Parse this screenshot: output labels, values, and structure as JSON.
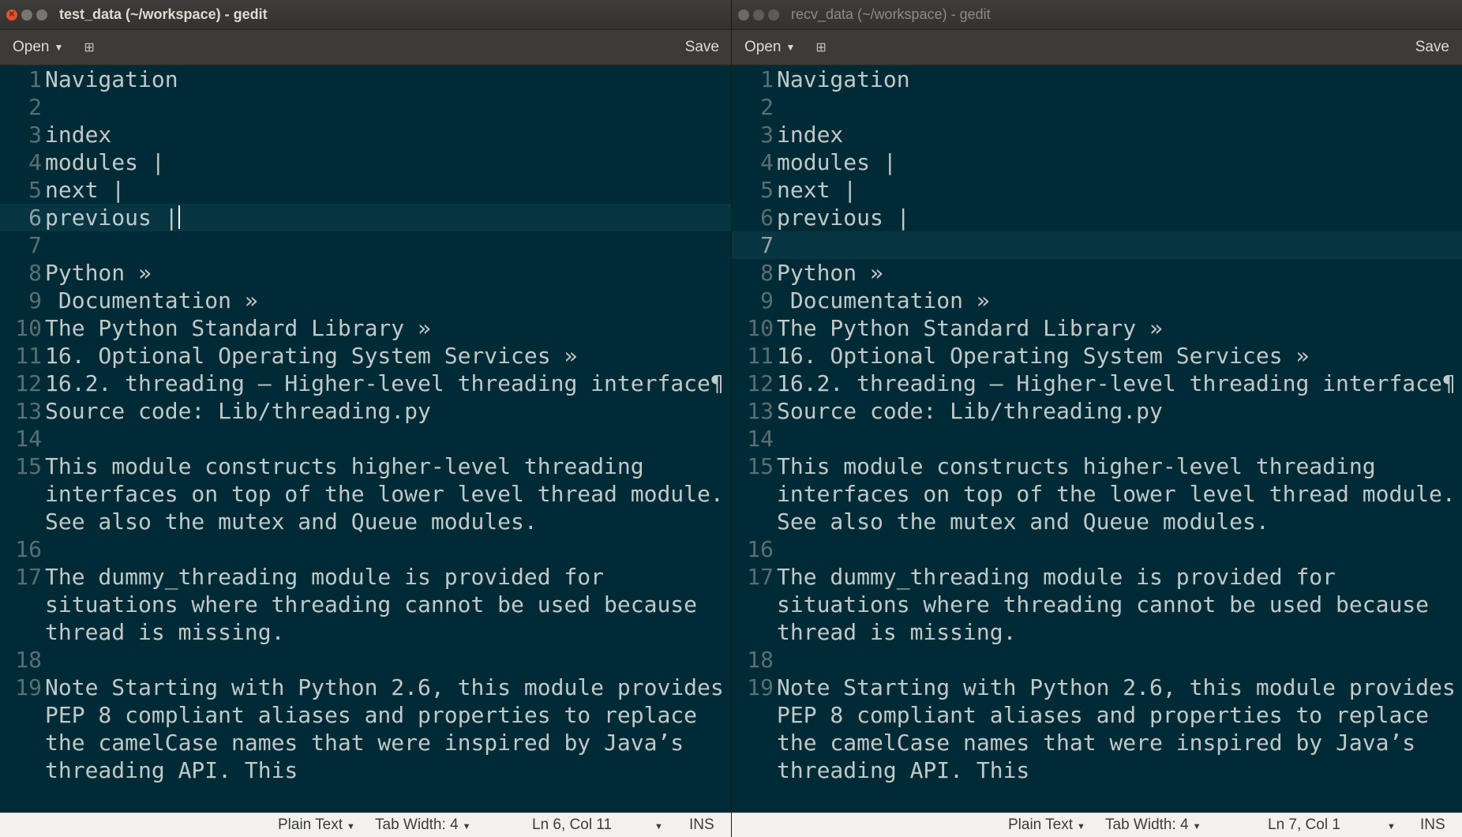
{
  "windows": [
    {
      "title": "test_data (~/workspace) - gedit",
      "active": true,
      "toolbar": {
        "open_label": "Open",
        "save_label": "Save"
      },
      "status": {
        "language": "Plain Text",
        "tab_width": "Tab Width: 4",
        "position": "Ln 6, Col 11",
        "mode": "INS"
      },
      "current_line": 6
    },
    {
      "title": "recv_data (~/workspace) - gedit",
      "active": false,
      "toolbar": {
        "open_label": "Open",
        "save_label": "Save"
      },
      "status": {
        "language": "Plain Text",
        "tab_width": "Tab Width: 4",
        "position": "Ln 7, Col 1",
        "mode": "INS"
      },
      "current_line": 7
    }
  ],
  "document_lines": [
    {
      "num": "1",
      "text": "Navigation"
    },
    {
      "num": "2",
      "text": ""
    },
    {
      "num": "3",
      "text": "index"
    },
    {
      "num": "4",
      "text": "modules |"
    },
    {
      "num": "5",
      "text": "next |"
    },
    {
      "num": "6",
      "text": "previous |"
    },
    {
      "num": "7",
      "text": ""
    },
    {
      "num": "8",
      "text": "Python »"
    },
    {
      "num": "9",
      "text": " Documentation »"
    },
    {
      "num": "10",
      "text": "The Python Standard Library »"
    },
    {
      "num": "11",
      "text": "16. Optional Operating System Services »"
    },
    {
      "num": "12",
      "text": "16.2. threading — Higher-level threading interface¶"
    },
    {
      "num": "13",
      "text": "Source code: Lib/threading.py"
    },
    {
      "num": "14",
      "text": ""
    },
    {
      "num": "15",
      "text": "This module constructs higher-level threading interfaces on top of the lower level thread module. See also the mutex and Queue modules."
    },
    {
      "num": "16",
      "text": ""
    },
    {
      "num": "17",
      "text": "The dummy_threading module is provided for situations where threading cannot be used because thread is missing."
    },
    {
      "num": "18",
      "text": ""
    },
    {
      "num": "19",
      "text": "Note Starting with Python 2.6, this module provides PEP 8 compliant aliases and properties to replace the camelCase names that were inspired by Java’s threading API. This"
    }
  ]
}
